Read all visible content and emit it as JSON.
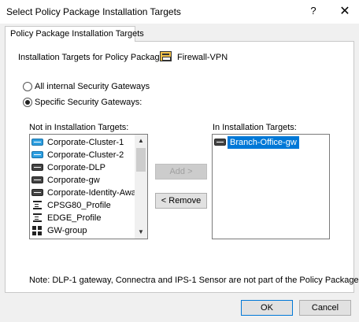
{
  "window": {
    "title": "Select Policy Package Installation Targets",
    "help_label": "?",
    "close_label": "✕"
  },
  "tab": {
    "label": "Policy Package Installation Targets"
  },
  "targets": {
    "label": "Installation Targets for Policy Package:",
    "package_name": "Firewall-VPN",
    "package_icon": "policy-package-icon"
  },
  "options": {
    "all_label": "All internal Security Gateways",
    "specific_label": "Specific Security Gateways:",
    "selected": "specific"
  },
  "not_in": {
    "label": "Not in Installation Targets:",
    "items": [
      {
        "label": "Corporate-Cluster-1",
        "icon": "cluster-icon"
      },
      {
        "label": "Corporate-Cluster-2",
        "icon": "cluster-icon"
      },
      {
        "label": "Corporate-DLP",
        "icon": "gateway-icon"
      },
      {
        "label": "Corporate-gw",
        "icon": "gateway-icon"
      },
      {
        "label": "Corporate-Identity-Awa",
        "icon": "gateway-icon"
      },
      {
        "label": "CPSG80_Profile",
        "icon": "profile-icon"
      },
      {
        "label": "EDGE_Profile",
        "icon": "profile-icon"
      },
      {
        "label": "GW-group",
        "icon": "group-icon"
      }
    ]
  },
  "in": {
    "label": "In Installation Targets:",
    "items": [
      {
        "label": "Branch-Office-gw",
        "icon": "gateway-icon"
      }
    ]
  },
  "buttons": {
    "add": "Add >",
    "remove": "< Remove",
    "ok": "OK",
    "cancel": "Cancel"
  },
  "note": "Note: DLP-1 gateway, Connectra and IPS-1 Sensor are not part of the Policy Package.",
  "colors": {
    "selection": "#0078d7",
    "cluster_icon": "#2e9fe0",
    "gateway_icon": "#444444"
  }
}
